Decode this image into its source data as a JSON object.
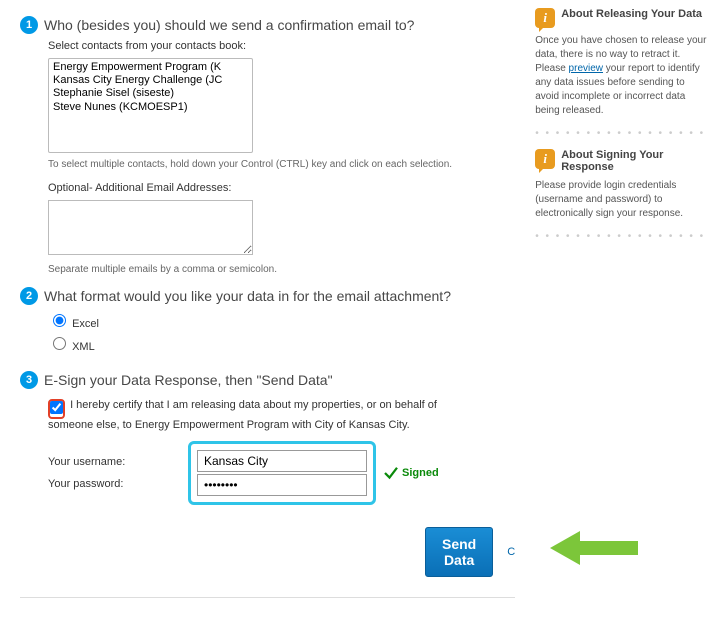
{
  "step1": {
    "title": "Who (besides you) should we send a confirmation email to?",
    "select_label": "Select contacts from your contacts book:",
    "contacts": [
      "Energy Empowerment Program (K",
      "Kansas City Energy Challenge (JC",
      "Stephanie Sisel (siseste)",
      "Steve Nunes (KCMOESP1)"
    ],
    "multiselect_hint": "To select multiple contacts, hold down your Control (CTRL) key and click on each selection.",
    "additional_label": "Optional- Additional Email Addresses:",
    "separate_hint": "Separate multiple emails by a comma or semicolon."
  },
  "step2": {
    "title": "What format would you like your data in for the email attachment?",
    "opt_excel": "Excel",
    "opt_xml": "XML",
    "selected": "Excel"
  },
  "step3": {
    "title": "E-Sign your Data Response, then \"Send Data\"",
    "certify_text": "I hereby certify that I am releasing data about my properties, or on behalf of someone else, to Energy Empowerment Program with City of Kansas City.",
    "username_label": "Your username:",
    "password_label": "Your password:",
    "username_value": "Kansas City",
    "password_value": "••••••••",
    "signed_label": "Signed"
  },
  "actions": {
    "send": "Send Data",
    "cancel_prefix": "C"
  },
  "sidebar": {
    "release": {
      "title": "About Releasing Your Data",
      "body_before": "Once you have chosen to release your data, there is no way to retract it. Please ",
      "link": "preview",
      "body_after": " your report to identify any data issues before sending to avoid incomplete or incorrect data being released."
    },
    "sign": {
      "title": "About Signing Your Response",
      "body": "Please provide login credentials (username and password) to electronically sign your response."
    }
  }
}
